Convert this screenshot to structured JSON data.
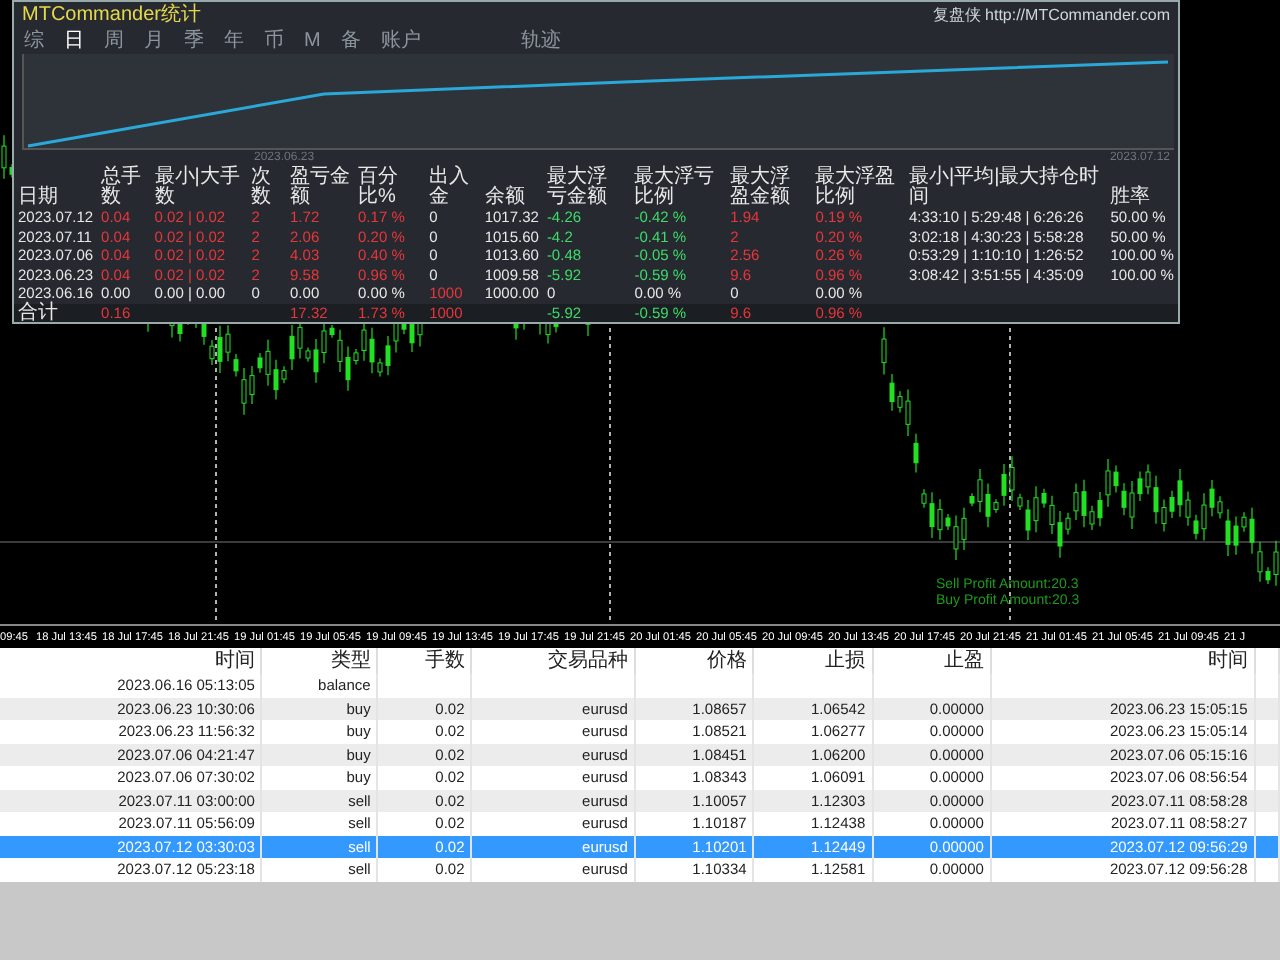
{
  "panel": {
    "title": "MTCommander统计",
    "site_label": "复盘侠 http://MTCommander.com",
    "tabs": [
      {
        "label": "综",
        "selected": false
      },
      {
        "label": "日",
        "selected": true
      },
      {
        "label": "周",
        "selected": false
      },
      {
        "label": "月",
        "selected": false
      },
      {
        "label": "季",
        "selected": false
      },
      {
        "label": "年",
        "selected": false
      },
      {
        "label": "币",
        "selected": false
      },
      {
        "label": "M",
        "selected": false
      },
      {
        "label": "备",
        "selected": false
      },
      {
        "label": "账户",
        "selected": false
      }
    ],
    "trail_tab": {
      "label": "轨迹",
      "selected": false
    },
    "chart_labels": [
      "2023.06.23",
      "2023.07.12"
    ],
    "stats": {
      "columns": [
        "日期",
        "总手数",
        "最小|大手数",
        "次数",
        "盈亏金额",
        "百分比%",
        "出入金",
        "余额",
        "最大浮亏金额",
        "最大浮亏比例",
        "最大浮盈金额",
        "最大浮盈比例",
        "最小|平均|最大持仓时间",
        "胜率"
      ],
      "rows": [
        {
          "cells": [
            {
              "text": "2023.07.12"
            },
            {
              "text": "0.04",
              "color": "#e8363a"
            },
            {
              "text": "0.02 | 0.02",
              "color": "#e8363a"
            },
            {
              "text": "2",
              "color": "#e8363a"
            },
            {
              "text": "1.72",
              "color": "#e8363a"
            },
            {
              "text": "0.17 %",
              "color": "#e8363a"
            },
            {
              "text": "0"
            },
            {
              "text": "1017.32"
            },
            {
              "text": "-4.26",
              "color": "#3fdc6a"
            },
            {
              "text": "-0.42 %",
              "color": "#3fdc6a"
            },
            {
              "text": "1.94",
              "color": "#e8363a"
            },
            {
              "text": "0.19 %",
              "color": "#e8363a"
            },
            {
              "text": "4:33:10 | 5:29:48 | 6:26:26"
            },
            {
              "text": "50.00 %"
            }
          ]
        },
        {
          "cells": [
            {
              "text": "2023.07.11"
            },
            {
              "text": "0.04",
              "color": "#e8363a"
            },
            {
              "text": "0.02 | 0.02",
              "color": "#e8363a"
            },
            {
              "text": "2",
              "color": "#e8363a"
            },
            {
              "text": "2.06",
              "color": "#e8363a"
            },
            {
              "text": "0.20 %",
              "color": "#e8363a"
            },
            {
              "text": "0"
            },
            {
              "text": "1015.60"
            },
            {
              "text": "-4.2",
              "color": "#3fdc6a"
            },
            {
              "text": "-0.41 %",
              "color": "#3fdc6a"
            },
            {
              "text": "2",
              "color": "#e8363a"
            },
            {
              "text": "0.20 %",
              "color": "#e8363a"
            },
            {
              "text": "3:02:18 | 4:30:23 | 5:58:28"
            },
            {
              "text": "50.00 %"
            }
          ]
        },
        {
          "cells": [
            {
              "text": "2023.07.06"
            },
            {
              "text": "0.04",
              "color": "#e8363a"
            },
            {
              "text": "0.02 | 0.02",
              "color": "#e8363a"
            },
            {
              "text": "2",
              "color": "#e8363a"
            },
            {
              "text": "4.03",
              "color": "#e8363a"
            },
            {
              "text": "0.40 %",
              "color": "#e8363a"
            },
            {
              "text": "0"
            },
            {
              "text": "1013.60"
            },
            {
              "text": "-0.48",
              "color": "#3fdc6a"
            },
            {
              "text": "-0.05 %",
              "color": "#3fdc6a"
            },
            {
              "text": "2.56",
              "color": "#e8363a"
            },
            {
              "text": "0.26 %",
              "color": "#e8363a"
            },
            {
              "text": "0:53:29 | 1:10:10 | 1:26:52"
            },
            {
              "text": "100.00 %"
            }
          ]
        },
        {
          "cells": [
            {
              "text": "2023.06.23"
            },
            {
              "text": "0.04",
              "color": "#e8363a"
            },
            {
              "text": "0.02 | 0.02",
              "color": "#e8363a"
            },
            {
              "text": "2",
              "color": "#e8363a"
            },
            {
              "text": "9.58",
              "color": "#e8363a"
            },
            {
              "text": "0.96 %",
              "color": "#e8363a"
            },
            {
              "text": "0"
            },
            {
              "text": "1009.58"
            },
            {
              "text": "-5.92",
              "color": "#3fdc6a"
            },
            {
              "text": "-0.59 %",
              "color": "#3fdc6a"
            },
            {
              "text": "9.6",
              "color": "#e8363a"
            },
            {
              "text": "0.96 %",
              "color": "#e8363a"
            },
            {
              "text": "3:08:42 | 3:51:55 | 4:35:09"
            },
            {
              "text": "100.00 %"
            }
          ]
        },
        {
          "cells": [
            {
              "text": "2023.06.16"
            },
            {
              "text": "0.00"
            },
            {
              "text": "0.00 | 0.00"
            },
            {
              "text": "0"
            },
            {
              "text": "0.00"
            },
            {
              "text": "0.00 %"
            },
            {
              "text": "1000",
              "color": "#e8363a"
            },
            {
              "text": "1000.00"
            },
            {
              "text": "0"
            },
            {
              "text": "0.00 %"
            },
            {
              "text": "0"
            },
            {
              "text": "0.00 %"
            },
            null,
            null
          ]
        }
      ],
      "total": {
        "cells": [
          {
            "text": "合计"
          },
          {
            "text": "0.16",
            "color": "#e8363a"
          },
          null,
          null,
          {
            "text": "17.32",
            "color": "#e8363a"
          },
          {
            "text": "1.73 %",
            "color": "#e8363a"
          },
          {
            "text": "1000",
            "color": "#e8363a"
          },
          null,
          {
            "text": "-5.92",
            "color": "#3fdc6a"
          },
          {
            "text": "-0.59 %",
            "color": "#3fdc6a"
          },
          {
            "text": "9.6",
            "color": "#e8363a"
          },
          {
            "text": "0.96 %",
            "color": "#e8363a"
          },
          null,
          null
        ]
      }
    }
  },
  "chart": {
    "time_labels": [
      "09:45",
      "18 Jul 13:45",
      "18 Jul 17:45",
      "18 Jul 21:45",
      "19 Jul 01:45",
      "19 Jul 05:45",
      "19 Jul 09:45",
      "19 Jul 13:45",
      "19 Jul 17:45",
      "19 Jul 21:45",
      "20 Jul 01:45",
      "20 Jul 05:45",
      "20 Jul 09:45",
      "20 Jul 13:45",
      "20 Jul 17:45",
      "20 Jul 21:45",
      "21 Jul 01:45",
      "21 Jul 05:45",
      "21 Jul 09:45",
      "21 J"
    ],
    "overlay_texts": [
      "Sell Profit Amount:20.3",
      "Buy Profit Amount:20.3"
    ]
  },
  "trades": {
    "columns": [
      "时间",
      "类型",
      "手数",
      "交易品种",
      "价格",
      "止损",
      "止盈",
      "时间"
    ],
    "rows": [
      {
        "cells": [
          "2023.06.16 05:13:05",
          "balance",
          null,
          null,
          null,
          null,
          null,
          null
        ],
        "selected": false
      },
      {
        "cells": [
          "2023.06.23 10:30:06",
          "buy",
          "0.02",
          "eurusd",
          "1.08657",
          "1.06542",
          "0.00000",
          "2023.06.23 15:05:15"
        ],
        "selected": false
      },
      {
        "cells": [
          "2023.06.23 11:56:32",
          "buy",
          "0.02",
          "eurusd",
          "1.08521",
          "1.06277",
          "0.00000",
          "2023.06.23 15:05:14"
        ],
        "selected": false
      },
      {
        "cells": [
          "2023.07.06 04:21:47",
          "buy",
          "0.02",
          "eurusd",
          "1.08451",
          "1.06200",
          "0.00000",
          "2023.07.06 05:15:16"
        ],
        "selected": false
      },
      {
        "cells": [
          "2023.07.06 07:30:02",
          "buy",
          "0.02",
          "eurusd",
          "1.08343",
          "1.06091",
          "0.00000",
          "2023.07.06 08:56:54"
        ],
        "selected": false
      },
      {
        "cells": [
          "2023.07.11 03:00:00",
          "sell",
          "0.02",
          "eurusd",
          "1.10057",
          "1.12303",
          "0.00000",
          "2023.07.11 08:58:28"
        ],
        "selected": false
      },
      {
        "cells": [
          "2023.07.11 05:56:09",
          "sell",
          "0.02",
          "eurusd",
          "1.10187",
          "1.12438",
          "0.00000",
          "2023.07.11 08:58:27"
        ],
        "selected": false
      },
      {
        "cells": [
          "2023.07.12 03:30:03",
          "sell",
          "0.02",
          "eurusd",
          "1.10201",
          "1.12449",
          "0.00000",
          "2023.07.12 09:56:29"
        ],
        "selected": true
      },
      {
        "cells": [
          "2023.07.12 05:23:18",
          "sell",
          "0.02",
          "eurusd",
          "1.10334",
          "1.12581",
          "0.00000",
          "2023.07.12 09:56:28"
        ],
        "selected": false
      }
    ]
  }
}
